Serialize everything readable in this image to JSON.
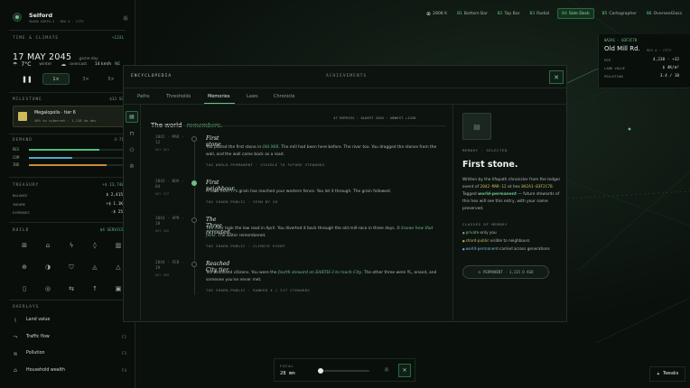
{
  "app": {
    "city_name": "Selford",
    "city_meta": "SHARD EARTH-3 · REG A · CITY",
    "brand_color": "#6fbf86"
  },
  "time_climate": {
    "title": "TIME & CLIMATE",
    "delta": "+1331",
    "date": "17 MAY 2045",
    "date_suffix": "game-day",
    "temp": "7°C",
    "season": "winter",
    "weather": "overcast",
    "wind": "14 km/h",
    "wind_dir": "NE",
    "speed_options": [
      "1×",
      "3×",
      "5×"
    ]
  },
  "milestone": {
    "title": "MILESTONE",
    "right": "$13 SC",
    "name": "Megalopolis · tier 6",
    "sub": "40% to cybernet · 1,118 km dev",
    "progress": 0.4
  },
  "demand": {
    "title": "DEMAND",
    "right": "4·71",
    "rows": [
      {
        "label": "RES",
        "value": 0.74,
        "color": "#4fbf7a"
      },
      {
        "label": "COM",
        "value": 0.46,
        "color": "#4fa8c8"
      },
      {
        "label": "IND",
        "value": 0.82,
        "color": "#c98a3a"
      }
    ]
  },
  "treasury": {
    "title": "TREASURY",
    "right": "+$ 13,740",
    "rows": [
      {
        "label": "BALANCE",
        "value": "$ 2,415"
      },
      {
        "label": "INCOME",
        "value": "+$ 1.1K"
      },
      {
        "label": "EXPENSES",
        "value": "-$ 25"
      }
    ]
  },
  "build": {
    "title": "BUILD",
    "right": "$4 SERVICE",
    "tools": [
      "grid-tool-icon",
      "house-tool-icon",
      "power-tool-icon",
      "water-tool-icon",
      "trash-tool-icon",
      "health-tool-icon",
      "education-tool-icon",
      "police-tool-icon",
      "fire-tool-icon",
      "warning-tool-icon",
      "transit-tool-icon",
      "bus-tool-icon",
      "car-tool-icon",
      "arrow-up-tool-icon",
      "lock-tool-icon"
    ]
  },
  "overlays": {
    "title": "OVERLAYS",
    "items": [
      {
        "label": "Land value",
        "key": ""
      },
      {
        "label": "Traffic flow",
        "key": "F2"
      },
      {
        "label": "Pollution",
        "key": "F3"
      },
      {
        "label": "Household wealth",
        "key": "F4"
      }
    ]
  },
  "topnav": {
    "items": [
      {
        "key": "",
        "label": "2808 K",
        "style": "globe"
      },
      {
        "key": "B1",
        "label": "Bottom Bar",
        "style": ""
      },
      {
        "key": "B2",
        "label": "Top Bar",
        "style": ""
      },
      {
        "key": "B3",
        "label": "Radial",
        "style": ""
      },
      {
        "key": "B4",
        "label": "Side Dock",
        "style": "active"
      },
      {
        "key": "B5",
        "label": "Cartographer",
        "style": ""
      },
      {
        "key": "B6",
        "label": "OverseeGlass",
        "style": ""
      },
      {
        "key": "",
        "label": "1x/ 3",
        "style": "boxed"
      }
    ]
  },
  "parcel": {
    "id": "8A2A1 · 03F2C78",
    "name": "Old Mill Rd.",
    "meta": "REG A · CITY",
    "rows": [
      {
        "label": "POP.",
        "value": "4,238 · +32"
      },
      {
        "label": "LAND VALUE",
        "value": "$ 4K/m²"
      },
      {
        "label": "POLLUTION",
        "value": "3.4 / 10"
      }
    ]
  },
  "encyclopedia": {
    "title": "ENCYCLOPEDIA",
    "achievements": "ACHIEVEMENTS",
    "tabs": [
      "Paths",
      "Thresholds",
      "Memories",
      "Laws",
      "Chronicle"
    ],
    "active_tab": 2,
    "heading": "The world",
    "heading_em": "remembers.",
    "stats": "47 ENTRIES · OLDEST 2042 · NEWEST +1330",
    "entries": [
      {
        "date": "2042 · MAR · 12",
        "day": "DAY 001",
        "title": "First stone.",
        "body_pre": "You placed the first stone in ",
        "body_em": "Old Mill",
        "body_post": ". The mill had been here before. The river too. You dragged the stones from the wall, and the wall came back as a road.",
        "tag": "TAG WORLD-PERMANENT · VISIBLE TO FUTURE STEWARDS"
      },
      {
        "date": "2042 · NOV · 04",
        "day": "DAY 237",
        "title": "First neighbour.",
        "body_pre": "A road from ",
        "body_em": "Ti",
        "body_post": "'s grain has reached your western fence. You let it through. The grain followed.",
        "tag": "TAG SHARD-PUBLIC · SEEN BY 28"
      },
      {
        "date": "2043 · APR · 18",
        "day": "DAY 402",
        "title": "The Three rerouted.",
        "body_pre": "The river took the low road in April. You diverted it back through the old mill-race in three days. ",
        "body_em": "It knows how that feels.",
        "body_post": " The water remembered.",
        "tag": "TAG SHARD-PUBLIC · CLIMATE EVENT"
      },
      {
        "date": "2044 · FEB · 19",
        "day": "DAY 689",
        "title": "Reached City tier.",
        "body_pre": "Ten thousand citizens. You were the ",
        "body_em": "fourth steward on EARTH-3 to reach City",
        "body_post": ". The other three were YL, anand, and someone you've never met.",
        "tag": "TAG SHARD-PUBLIC · RANKED 4 / 217 STEWARDS"
      }
    ],
    "detail": {
      "kind": "MEMORY · SELECTED",
      "title": "First stone.",
      "body1": "Written by the lifepath chronicler from the ledger event of",
      "ledger_date": "2042-MAR-12",
      "body2": "at hex",
      "hex": "8A2A1-03F2C78",
      "body3": ". Tagged",
      "tag": "world-permanent",
      "body4": "— future stewards of this hex will see this entry, with your name preserved.",
      "classes_title": "CLASSES OF MEMORY",
      "classes": [
        {
          "name": "private",
          "desc": "·only you",
          "color": "#6fbf86"
        },
        {
          "name": "shard-public",
          "desc": "·visible to neighbours",
          "color": "#cdb95a"
        },
        {
          "name": "world-permanent",
          "desc": "·carried across generations",
          "color": "#7ab4d8"
        }
      ],
      "badge": "PERMANENT · 1,115 D AGO"
    }
  },
  "focal": {
    "label": "FOCAL",
    "value": "28 mm",
    "slider": 0.05
  },
  "tweaks": "Tweaks"
}
